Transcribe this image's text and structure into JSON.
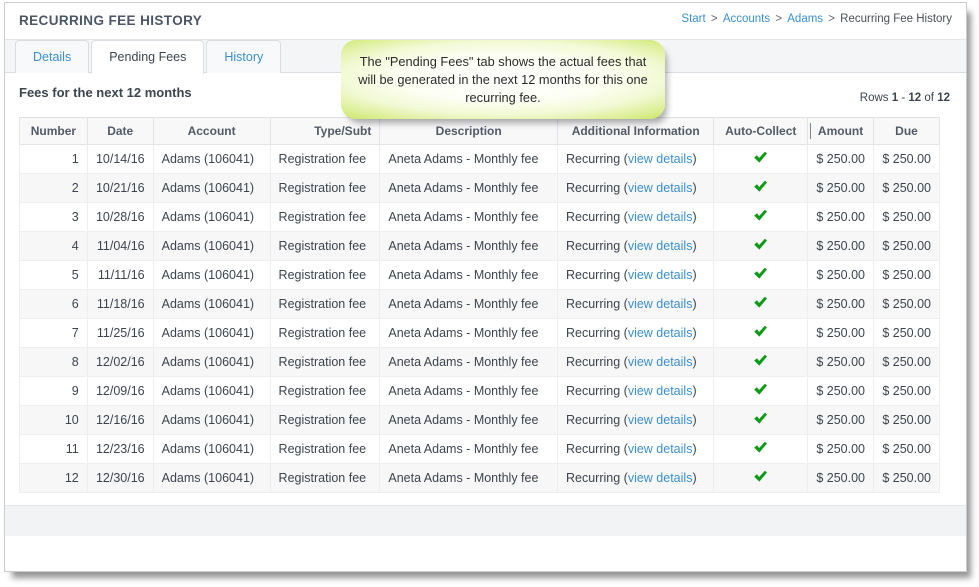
{
  "window": {
    "title": "RECURRING FEE HISTORY"
  },
  "breadcrumb": {
    "items": [
      {
        "label": "Start",
        "link": true
      },
      {
        "label": "Accounts",
        "link": true
      },
      {
        "label": "Adams",
        "link": true
      },
      {
        "label": "Recurring Fee History",
        "link": false
      }
    ],
    "separator": ">"
  },
  "tabs": [
    {
      "label": "Details",
      "active": false
    },
    {
      "label": "Pending Fees",
      "active": true
    },
    {
      "label": "History",
      "active": false
    }
  ],
  "callout": {
    "text": "The \"Pending Fees\" tab shows the actual fees that will be generated in the next 12 months for this one recurring fee.",
    "border_color": "#c5e355",
    "fill_color": "#ffffff"
  },
  "main": {
    "section_heading": "Fees for the next 12 months",
    "rows_indicator": {
      "prefix": "Rows",
      "from": "1",
      "dash": "-",
      "to": "12",
      "of_word": "of",
      "total": "12"
    }
  },
  "table": {
    "columns": [
      "Number",
      "Date",
      "Account",
      "Type/Subt",
      "Description",
      "Additional Information",
      "Auto-Collect",
      "Amount",
      "Due"
    ],
    "view_details_label": "view details",
    "auto_collect_icon": "check-icon",
    "auto_collect_color": "#0a9a15",
    "rows": [
      {
        "number": "1",
        "date": "10/14/16",
        "account": "Adams (106041)",
        "type": "Registration fee",
        "description": "Aneta Adams - Monthly fee",
        "additional": "Recurring",
        "auto_collect": true,
        "amount": "$ 250.00",
        "due": "$ 250.00"
      },
      {
        "number": "2",
        "date": "10/21/16",
        "account": "Adams (106041)",
        "type": "Registration fee",
        "description": "Aneta Adams - Monthly fee",
        "additional": "Recurring",
        "auto_collect": true,
        "amount": "$ 250.00",
        "due": "$ 250.00"
      },
      {
        "number": "3",
        "date": "10/28/16",
        "account": "Adams (106041)",
        "type": "Registration fee",
        "description": "Aneta Adams - Monthly fee",
        "additional": "Recurring",
        "auto_collect": true,
        "amount": "$ 250.00",
        "due": "$ 250.00"
      },
      {
        "number": "4",
        "date": "11/04/16",
        "account": "Adams (106041)",
        "type": "Registration fee",
        "description": "Aneta Adams - Monthly fee",
        "additional": "Recurring",
        "auto_collect": true,
        "amount": "$ 250.00",
        "due": "$ 250.00"
      },
      {
        "number": "5",
        "date": "11/11/16",
        "account": "Adams (106041)",
        "type": "Registration fee",
        "description": "Aneta Adams - Monthly fee",
        "additional": "Recurring",
        "auto_collect": true,
        "amount": "$ 250.00",
        "due": "$ 250.00"
      },
      {
        "number": "6",
        "date": "11/18/16",
        "account": "Adams (106041)",
        "type": "Registration fee",
        "description": "Aneta Adams - Monthly fee",
        "additional": "Recurring",
        "auto_collect": true,
        "amount": "$ 250.00",
        "due": "$ 250.00"
      },
      {
        "number": "7",
        "date": "11/25/16",
        "account": "Adams (106041)",
        "type": "Registration fee",
        "description": "Aneta Adams - Monthly fee",
        "additional": "Recurring",
        "auto_collect": true,
        "amount": "$ 250.00",
        "due": "$ 250.00"
      },
      {
        "number": "8",
        "date": "12/02/16",
        "account": "Adams (106041)",
        "type": "Registration fee",
        "description": "Aneta Adams - Monthly fee",
        "additional": "Recurring",
        "auto_collect": true,
        "amount": "$ 250.00",
        "due": "$ 250.00"
      },
      {
        "number": "9",
        "date": "12/09/16",
        "account": "Adams (106041)",
        "type": "Registration fee",
        "description": "Aneta Adams - Monthly fee",
        "additional": "Recurring",
        "auto_collect": true,
        "amount": "$ 250.00",
        "due": "$ 250.00"
      },
      {
        "number": "10",
        "date": "12/16/16",
        "account": "Adams (106041)",
        "type": "Registration fee",
        "description": "Aneta Adams - Monthly fee",
        "additional": "Recurring",
        "auto_collect": true,
        "amount": "$ 250.00",
        "due": "$ 250.00"
      },
      {
        "number": "11",
        "date": "12/23/16",
        "account": "Adams (106041)",
        "type": "Registration fee",
        "description": "Aneta Adams - Monthly fee",
        "additional": "Recurring",
        "auto_collect": true,
        "amount": "$ 250.00",
        "due": "$ 250.00"
      },
      {
        "number": "12",
        "date": "12/30/16",
        "account": "Adams (106041)",
        "type": "Registration fee",
        "description": "Aneta Adams - Monthly fee",
        "additional": "Recurring",
        "auto_collect": true,
        "amount": "$ 250.00",
        "due": "$ 250.00"
      }
    ]
  },
  "colors": {
    "link": "#3a8fd0",
    "text": "#3d444e",
    "header_text": "#525a66",
    "check_green": "#0a9a15",
    "row_stripe": "#f7f7f8"
  }
}
